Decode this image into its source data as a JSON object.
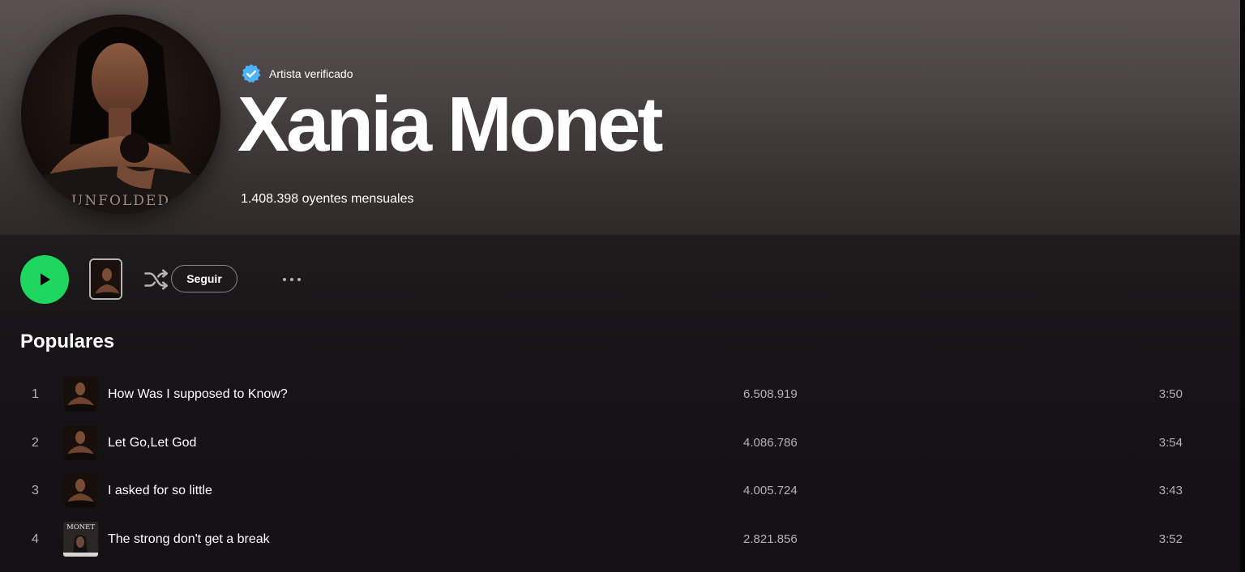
{
  "artist": {
    "verified_label": "Artista verificado",
    "name": "Xania Monet",
    "monthly_listeners": "1.408.398 oyentes mensuales",
    "cover_text": "UNFOLDED"
  },
  "controls": {
    "follow_label": "Seguir",
    "icons": {
      "play": "play-icon",
      "shuffle": "shuffle-icon",
      "more": "more-options-icon",
      "verified": "verified-badge-icon"
    }
  },
  "popular": {
    "title": "Populares",
    "tracks": [
      {
        "number": "1",
        "title": "How Was I supposed to Know?",
        "plays": "6.508.919",
        "duration": "3:50",
        "cover": "unfolded"
      },
      {
        "number": "2",
        "title": "Let Go,Let God",
        "plays": "4.086.786",
        "duration": "3:54",
        "cover": "unfolded"
      },
      {
        "number": "3",
        "title": "I asked for so little",
        "plays": "4.005.724",
        "duration": "3:43",
        "cover": "unfolded"
      },
      {
        "number": "4",
        "title": "The strong don't get a break",
        "plays": "2.821.856",
        "duration": "3:52",
        "cover": "monet",
        "cover_text": "MONET"
      }
    ]
  },
  "colors": {
    "accent": "#1ed760",
    "verified_blue": "#4cb3ff",
    "text_secondary": "#b3b3b3"
  }
}
